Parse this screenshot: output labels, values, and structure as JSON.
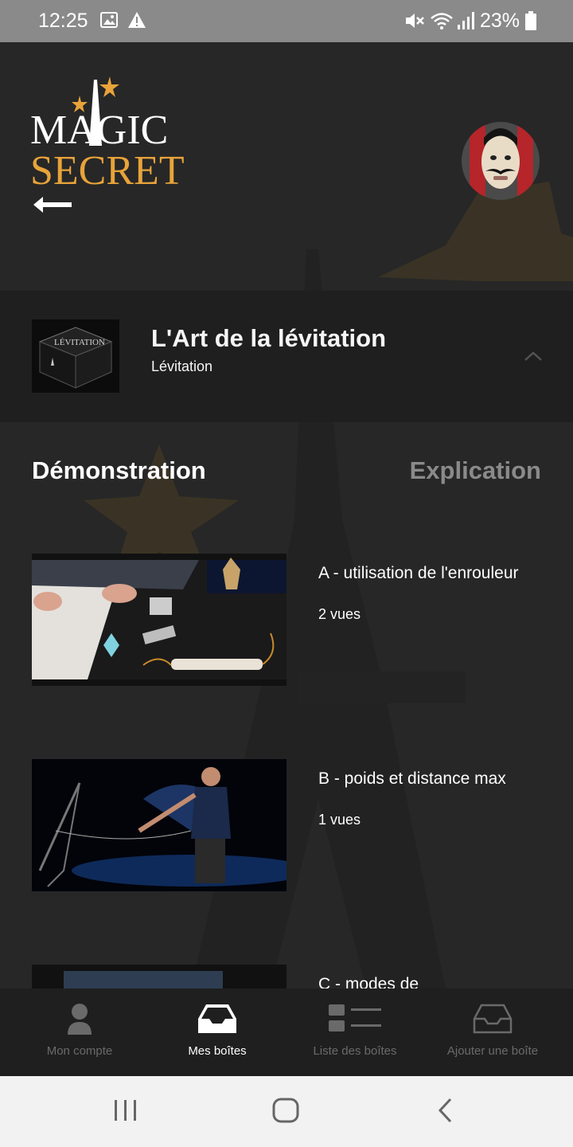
{
  "status_bar": {
    "time": "12:25",
    "battery": "23%",
    "icons": [
      "image-icon",
      "warning-icon",
      "mute-icon",
      "wifi-icon",
      "signal-icon",
      "battery-icon"
    ]
  },
  "header": {
    "logo_line1": "MAGIC",
    "logo_line2": "SECRET"
  },
  "box": {
    "title": "L'Art de la lévitation",
    "subtitle": "Lévitation",
    "thumb_text": "LÉVITATION"
  },
  "tabs": {
    "demo": "Démonstration",
    "expl": "Explication"
  },
  "videos": [
    {
      "title": "A - utilisation de l'enrouleur",
      "views": "2 vues"
    },
    {
      "title": "B - poids et distance max",
      "views": "1 vues"
    },
    {
      "title": "C - modes de",
      "views": ""
    }
  ],
  "bottom_nav": [
    {
      "label": "Mon compte",
      "icon": "person-icon",
      "active": false
    },
    {
      "label": "Mes boîtes",
      "icon": "inbox-icon",
      "active": true
    },
    {
      "label": "Liste des boîtes",
      "icon": "list-icon",
      "active": false
    },
    {
      "label": "Ajouter une boîte",
      "icon": "add-box-icon",
      "active": false
    }
  ],
  "colors": {
    "accent": "#e8a33a",
    "background": "#272727",
    "panel": "#1f1f1f",
    "inactive": "#6a6a6a"
  }
}
